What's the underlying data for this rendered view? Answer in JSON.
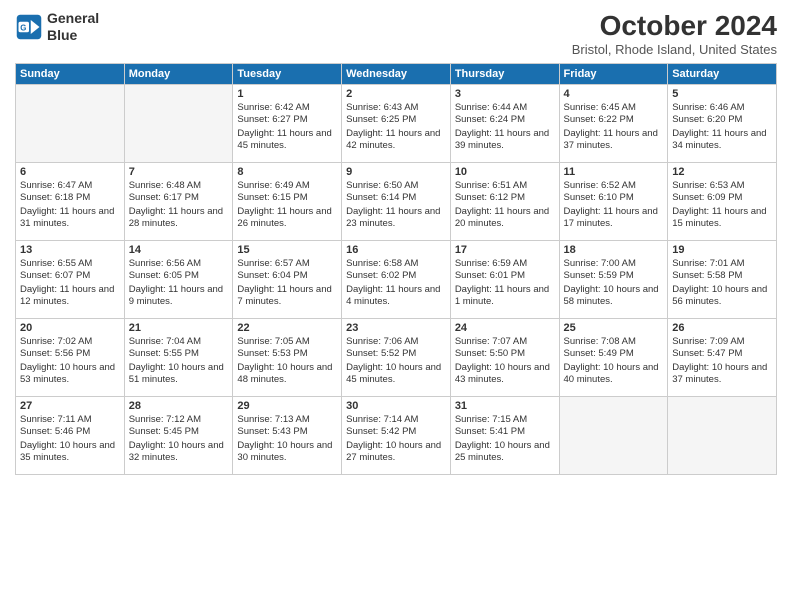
{
  "logo": {
    "line1": "General",
    "line2": "Blue"
  },
  "title": "October 2024",
  "location": "Bristol, Rhode Island, United States",
  "days_of_week": [
    "Sunday",
    "Monday",
    "Tuesday",
    "Wednesday",
    "Thursday",
    "Friday",
    "Saturday"
  ],
  "weeks": [
    [
      {
        "day": "",
        "content": ""
      },
      {
        "day": "",
        "content": ""
      },
      {
        "day": "1",
        "content": "Sunrise: 6:42 AM\nSunset: 6:27 PM\nDaylight: 11 hours and 45 minutes."
      },
      {
        "day": "2",
        "content": "Sunrise: 6:43 AM\nSunset: 6:25 PM\nDaylight: 11 hours and 42 minutes."
      },
      {
        "day": "3",
        "content": "Sunrise: 6:44 AM\nSunset: 6:24 PM\nDaylight: 11 hours and 39 minutes."
      },
      {
        "day": "4",
        "content": "Sunrise: 6:45 AM\nSunset: 6:22 PM\nDaylight: 11 hours and 37 minutes."
      },
      {
        "day": "5",
        "content": "Sunrise: 6:46 AM\nSunset: 6:20 PM\nDaylight: 11 hours and 34 minutes."
      }
    ],
    [
      {
        "day": "6",
        "content": "Sunrise: 6:47 AM\nSunset: 6:18 PM\nDaylight: 11 hours and 31 minutes."
      },
      {
        "day": "7",
        "content": "Sunrise: 6:48 AM\nSunset: 6:17 PM\nDaylight: 11 hours and 28 minutes."
      },
      {
        "day": "8",
        "content": "Sunrise: 6:49 AM\nSunset: 6:15 PM\nDaylight: 11 hours and 26 minutes."
      },
      {
        "day": "9",
        "content": "Sunrise: 6:50 AM\nSunset: 6:14 PM\nDaylight: 11 hours and 23 minutes."
      },
      {
        "day": "10",
        "content": "Sunrise: 6:51 AM\nSunset: 6:12 PM\nDaylight: 11 hours and 20 minutes."
      },
      {
        "day": "11",
        "content": "Sunrise: 6:52 AM\nSunset: 6:10 PM\nDaylight: 11 hours and 17 minutes."
      },
      {
        "day": "12",
        "content": "Sunrise: 6:53 AM\nSunset: 6:09 PM\nDaylight: 11 hours and 15 minutes."
      }
    ],
    [
      {
        "day": "13",
        "content": "Sunrise: 6:55 AM\nSunset: 6:07 PM\nDaylight: 11 hours and 12 minutes."
      },
      {
        "day": "14",
        "content": "Sunrise: 6:56 AM\nSunset: 6:05 PM\nDaylight: 11 hours and 9 minutes."
      },
      {
        "day": "15",
        "content": "Sunrise: 6:57 AM\nSunset: 6:04 PM\nDaylight: 11 hours and 7 minutes."
      },
      {
        "day": "16",
        "content": "Sunrise: 6:58 AM\nSunset: 6:02 PM\nDaylight: 11 hours and 4 minutes."
      },
      {
        "day": "17",
        "content": "Sunrise: 6:59 AM\nSunset: 6:01 PM\nDaylight: 11 hours and 1 minute."
      },
      {
        "day": "18",
        "content": "Sunrise: 7:00 AM\nSunset: 5:59 PM\nDaylight: 10 hours and 58 minutes."
      },
      {
        "day": "19",
        "content": "Sunrise: 7:01 AM\nSunset: 5:58 PM\nDaylight: 10 hours and 56 minutes."
      }
    ],
    [
      {
        "day": "20",
        "content": "Sunrise: 7:02 AM\nSunset: 5:56 PM\nDaylight: 10 hours and 53 minutes."
      },
      {
        "day": "21",
        "content": "Sunrise: 7:04 AM\nSunset: 5:55 PM\nDaylight: 10 hours and 51 minutes."
      },
      {
        "day": "22",
        "content": "Sunrise: 7:05 AM\nSunset: 5:53 PM\nDaylight: 10 hours and 48 minutes."
      },
      {
        "day": "23",
        "content": "Sunrise: 7:06 AM\nSunset: 5:52 PM\nDaylight: 10 hours and 45 minutes."
      },
      {
        "day": "24",
        "content": "Sunrise: 7:07 AM\nSunset: 5:50 PM\nDaylight: 10 hours and 43 minutes."
      },
      {
        "day": "25",
        "content": "Sunrise: 7:08 AM\nSunset: 5:49 PM\nDaylight: 10 hours and 40 minutes."
      },
      {
        "day": "26",
        "content": "Sunrise: 7:09 AM\nSunset: 5:47 PM\nDaylight: 10 hours and 37 minutes."
      }
    ],
    [
      {
        "day": "27",
        "content": "Sunrise: 7:11 AM\nSunset: 5:46 PM\nDaylight: 10 hours and 35 minutes."
      },
      {
        "day": "28",
        "content": "Sunrise: 7:12 AM\nSunset: 5:45 PM\nDaylight: 10 hours and 32 minutes."
      },
      {
        "day": "29",
        "content": "Sunrise: 7:13 AM\nSunset: 5:43 PM\nDaylight: 10 hours and 30 minutes."
      },
      {
        "day": "30",
        "content": "Sunrise: 7:14 AM\nSunset: 5:42 PM\nDaylight: 10 hours and 27 minutes."
      },
      {
        "day": "31",
        "content": "Sunrise: 7:15 AM\nSunset: 5:41 PM\nDaylight: 10 hours and 25 minutes."
      },
      {
        "day": "",
        "content": ""
      },
      {
        "day": "",
        "content": ""
      }
    ]
  ]
}
